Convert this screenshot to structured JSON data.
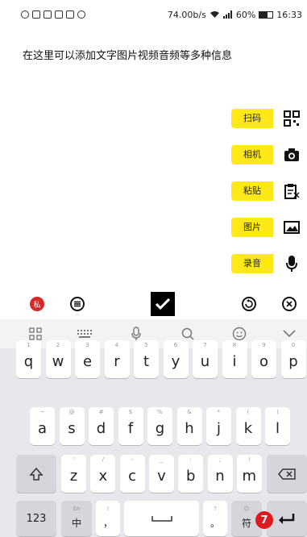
{
  "status_bar": {
    "speed": "74.00b/s",
    "battery": "60%",
    "time": "16:33"
  },
  "editor": {
    "placeholder": "在这里可以添加文字图片视频音频等多种信息"
  },
  "actions": [
    {
      "label": "扫码",
      "icon": "qr-code-icon"
    },
    {
      "label": "相机",
      "icon": "camera-icon"
    },
    {
      "label": "粘贴",
      "icon": "paste-icon"
    },
    {
      "label": "图片",
      "icon": "image-icon"
    },
    {
      "label": "录音",
      "icon": "microphone-icon"
    }
  ],
  "toolbar": {
    "private_label": "私"
  },
  "keyboard": {
    "row1": [
      {
        "hint": "1",
        "key": "q"
      },
      {
        "hint": "2",
        "key": "w"
      },
      {
        "hint": "3",
        "key": "e"
      },
      {
        "hint": "4",
        "key": "r"
      },
      {
        "hint": "5",
        "key": "t"
      },
      {
        "hint": "6",
        "key": "y"
      },
      {
        "hint": "7",
        "key": "u"
      },
      {
        "hint": "8",
        "key": "i"
      },
      {
        "hint": "9",
        "key": "o"
      },
      {
        "hint": "0",
        "key": "p"
      }
    ],
    "row2": [
      {
        "hint": "~",
        "key": "a"
      },
      {
        "hint": "@",
        "key": "s"
      },
      {
        "hint": "#",
        "key": "d"
      },
      {
        "hint": "$",
        "key": "f"
      },
      {
        "hint": "%",
        "key": "g"
      },
      {
        "hint": "&",
        "key": "h"
      },
      {
        "hint": "*",
        "key": "j"
      },
      {
        "hint": "(",
        "key": "k"
      },
      {
        "hint": ")",
        "key": "l"
      }
    ],
    "row3": [
      {
        "hint": "'",
        "key": "z"
      },
      {
        "hint": "/",
        "key": "x"
      },
      {
        "hint": "-",
        "key": "c"
      },
      {
        "hint": "_",
        "key": "v"
      },
      {
        "hint": ":",
        "key": "b"
      },
      {
        "hint": ";",
        "key": "n"
      },
      {
        "hint": "!",
        "key": "m"
      }
    ],
    "num_label": "123",
    "lang_sub": "En",
    "lang_label": "中",
    "comma_hint": "!",
    "comma": "，",
    "period_hint": "?",
    "period": "。",
    "symbol_sub": "☺",
    "symbol_label": "符"
  },
  "badge": "7",
  "colors": {
    "accent_yellow": "#ffe817",
    "private_red": "#d42a2a",
    "badge_red": "#e0191f"
  }
}
